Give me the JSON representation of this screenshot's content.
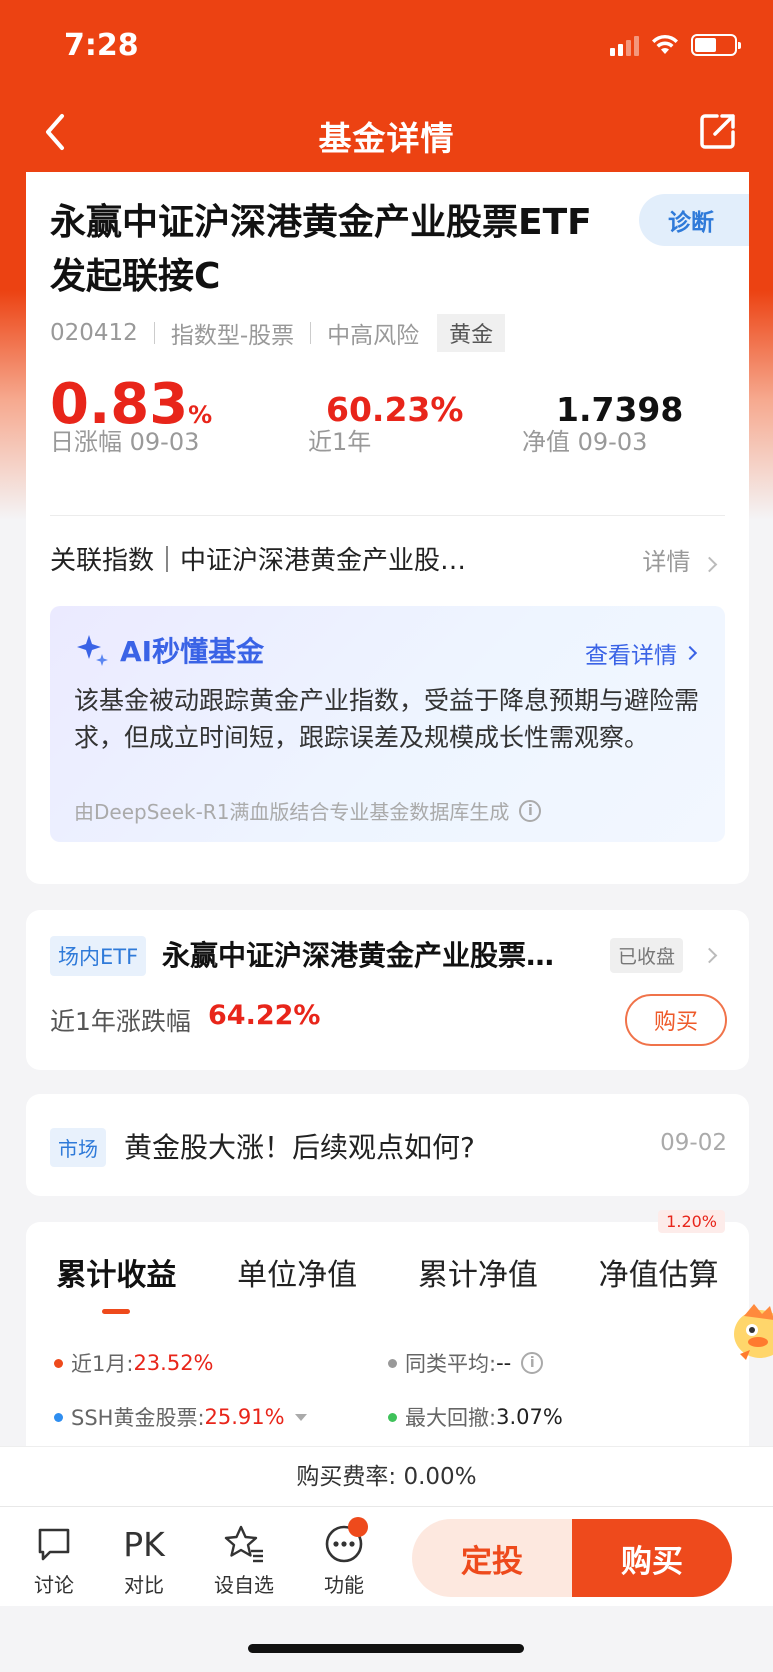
{
  "status_bar": {
    "time": "7:28"
  },
  "nav": {
    "title": "基金详情"
  },
  "fund": {
    "name": "永赢中证沪深港黄金产业股票ETF发起联接C",
    "code": "020412",
    "type": "指数型-股票",
    "risk": "中高风险",
    "tag": "黄金",
    "diagnose_label": "诊断",
    "daily_change": "0.83",
    "daily_change_unit": "%",
    "daily_change_label": "日涨幅 09-03",
    "year_return": "60.23%",
    "year_return_label": "近1年",
    "nav_value": "1.7398",
    "nav_label": "净值 09-03"
  },
  "related_index": {
    "label": "关联指数｜",
    "name": "中证沪深港黄金产业股…",
    "detail_label": "详情"
  },
  "ai_summary": {
    "title": "AI秒懂基金",
    "more_label": "查看详情",
    "text": "该基金被动跟踪黄金产业指数，受益于降息预期与避险需求，但成立时间短，跟踪误差及规模成长性需观察。",
    "source": "由DeepSeek-R1满血版结合专业基金数据库生成"
  },
  "etf": {
    "tag": "场内ETF",
    "name": "永赢中证沪深港黄金产业股票…",
    "status": "已收盘",
    "perf_label": "近1年涨跌幅",
    "perf_value": "64.22%",
    "buy_label": "购买"
  },
  "news": {
    "tag": "市场",
    "title": "黄金股大涨！后续观点如何?",
    "date": "09-02"
  },
  "chart_tabs": {
    "tabs": [
      "累计收益",
      "单位净值",
      "累计净值",
      "净值估算"
    ],
    "active_index": 0,
    "estimate_badge": "1.20%",
    "legend": [
      {
        "label": "近1月: ",
        "value": "23.52%",
        "color": "#ee4a1c"
      },
      {
        "label": "同类平均: ",
        "value": "--",
        "color": "#999999"
      },
      {
        "label": "SSH黄金股票: ",
        "value": "25.91%",
        "color": "#2f8ef0"
      },
      {
        "label": "最大回撤: ",
        "value": "3.07%",
        "color": "#3fc25a"
      }
    ]
  },
  "fee": {
    "text": "购买费率: 0.00%"
  },
  "bottom_bar": {
    "items": [
      {
        "label": "讨论",
        "icon": "chat-bubble-icon"
      },
      {
        "label": "对比",
        "icon": "PK"
      },
      {
        "label": "设自选",
        "icon": "star-list-icon"
      },
      {
        "label": "功能",
        "icon": "more-dots-icon"
      }
    ],
    "invest_label": "定投",
    "buy_label": "购买"
  },
  "colors": {
    "brand": "#ec4212",
    "rise": "#e8251a",
    "link": "#2f7ad9"
  }
}
